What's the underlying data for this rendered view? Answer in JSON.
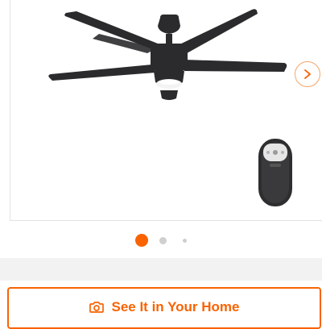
{
  "colors": {
    "brand_orange": "#f96302",
    "band_gray": "#f2f2f2",
    "dot_inactive": "#cfcfcf"
  },
  "gallery": {
    "image": "ceiling-fan-with-light-kit-and-remote",
    "next_icon": "chevron-right-icon",
    "slides": {
      "count": 3,
      "active_index": 0
    }
  },
  "actions": {
    "see_it_label": "See It in Your Home",
    "see_it_icon": "camera-icon"
  }
}
